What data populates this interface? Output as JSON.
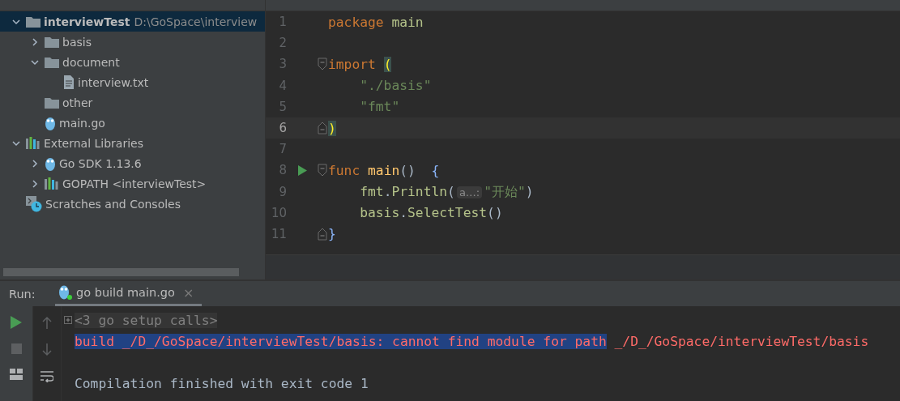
{
  "project_tree": [
    {
      "label": "interviewTest",
      "path": "D:\\GoSpace\\interview",
      "kind": "module",
      "expanded": true,
      "selected": true,
      "children": [
        {
          "label": "basis",
          "kind": "folder",
          "expanded": false,
          "selected": false
        },
        {
          "label": "document",
          "kind": "folder",
          "expanded": true,
          "selected": false,
          "children": [
            {
              "label": "interview.txt",
              "kind": "file",
              "selected": false
            }
          ]
        },
        {
          "label": "other",
          "kind": "folder",
          "selected": false
        },
        {
          "label": "main.go",
          "kind": "gopher",
          "selected": false
        }
      ]
    },
    {
      "label": "External Libraries",
      "kind": "library",
      "expanded": true,
      "selected": false,
      "children": [
        {
          "label": "Go SDK 1.13.6",
          "kind": "gopher",
          "expanded": false,
          "selected": false
        },
        {
          "label": "GOPATH <interviewTest>",
          "kind": "library",
          "expanded": false,
          "selected": false
        }
      ]
    },
    {
      "label": "Scratches and Consoles",
      "kind": "scratches",
      "selected": false
    }
  ],
  "editor": {
    "lines": [
      {
        "number": "1",
        "kind": "plain",
        "current": false,
        "tokens": [
          {
            "text": "package",
            "kind": "keyword"
          },
          {
            "text": " main",
            "kind": "package"
          }
        ]
      },
      {
        "number": "2",
        "kind": "plain",
        "current": false
      },
      {
        "number": "3",
        "kind": "fold_start",
        "current": false,
        "tokens": [
          {
            "text": "import ",
            "kind": "keyword"
          },
          {
            "text": "(",
            "kind": "match"
          }
        ]
      },
      {
        "number": "4",
        "kind": "plain",
        "current": false,
        "tokens": [
          {
            "text": "    \"./basis\"",
            "kind": "string"
          }
        ]
      },
      {
        "number": "5",
        "kind": "plain",
        "current": false,
        "tokens": [
          {
            "text": "    \"fmt\"",
            "kind": "string"
          }
        ]
      },
      {
        "number": "6",
        "kind": "fold_end",
        "current": true,
        "tokens": [
          {
            "text": ")",
            "kind": "match"
          }
        ]
      },
      {
        "number": "7",
        "kind": "plain",
        "current": false
      },
      {
        "number": "8",
        "kind": "fold_start",
        "current": false,
        "run_marker": true,
        "tokens": [
          {
            "text": "func",
            "kind": "keyword"
          },
          {
            "text": " main",
            "kind": "funcname"
          },
          {
            "text": "()",
            "kind": "punct"
          },
          {
            "text": "  {",
            "kind": "brace"
          }
        ]
      },
      {
        "number": "9",
        "kind": "plain",
        "current": false,
        "tokens": [
          {
            "text": "    fmt",
            "kind": "package"
          },
          {
            "text": ".",
            "kind": "punct"
          },
          {
            "text": "Println",
            "kind": "package"
          },
          {
            "text": "(",
            "kind": "punct"
          },
          {
            "text": "a…:",
            "kind": "hint"
          },
          {
            "text": "\"开始\"",
            "kind": "string"
          },
          {
            "text": ")",
            "kind": "punct"
          }
        ]
      },
      {
        "number": "10",
        "kind": "plain",
        "current": false,
        "tokens": [
          {
            "text": "    basis",
            "kind": "package"
          },
          {
            "text": ".",
            "kind": "punct"
          },
          {
            "text": "SelectTest",
            "kind": "package"
          },
          {
            "text": "()",
            "kind": "punct"
          }
        ]
      },
      {
        "number": "11",
        "kind": "fold_end",
        "current": false,
        "tokens": [
          {
            "text": "}",
            "kind": "brace"
          }
        ]
      }
    ]
  },
  "run_panel": {
    "label": "Run:",
    "tab": {
      "title": "go build main.go",
      "close": "×",
      "selected": true
    },
    "console": [
      {
        "kind": "folded",
        "segments": [
          {
            "text": "<3 go setup calls>",
            "selected": false
          }
        ]
      },
      {
        "kind": "error",
        "segments": [
          {
            "text": "build _/D_/GoSpace/interviewTest/basis: cannot find module for path",
            "selected": true
          },
          {
            "text": " _/D_/GoSpace/interviewTest/basis",
            "selected": false
          }
        ]
      },
      {
        "kind": "blank"
      },
      {
        "kind": "info",
        "segments": [
          {
            "text": "Compilation finished with exit code 1",
            "selected": false
          }
        ]
      }
    ]
  }
}
